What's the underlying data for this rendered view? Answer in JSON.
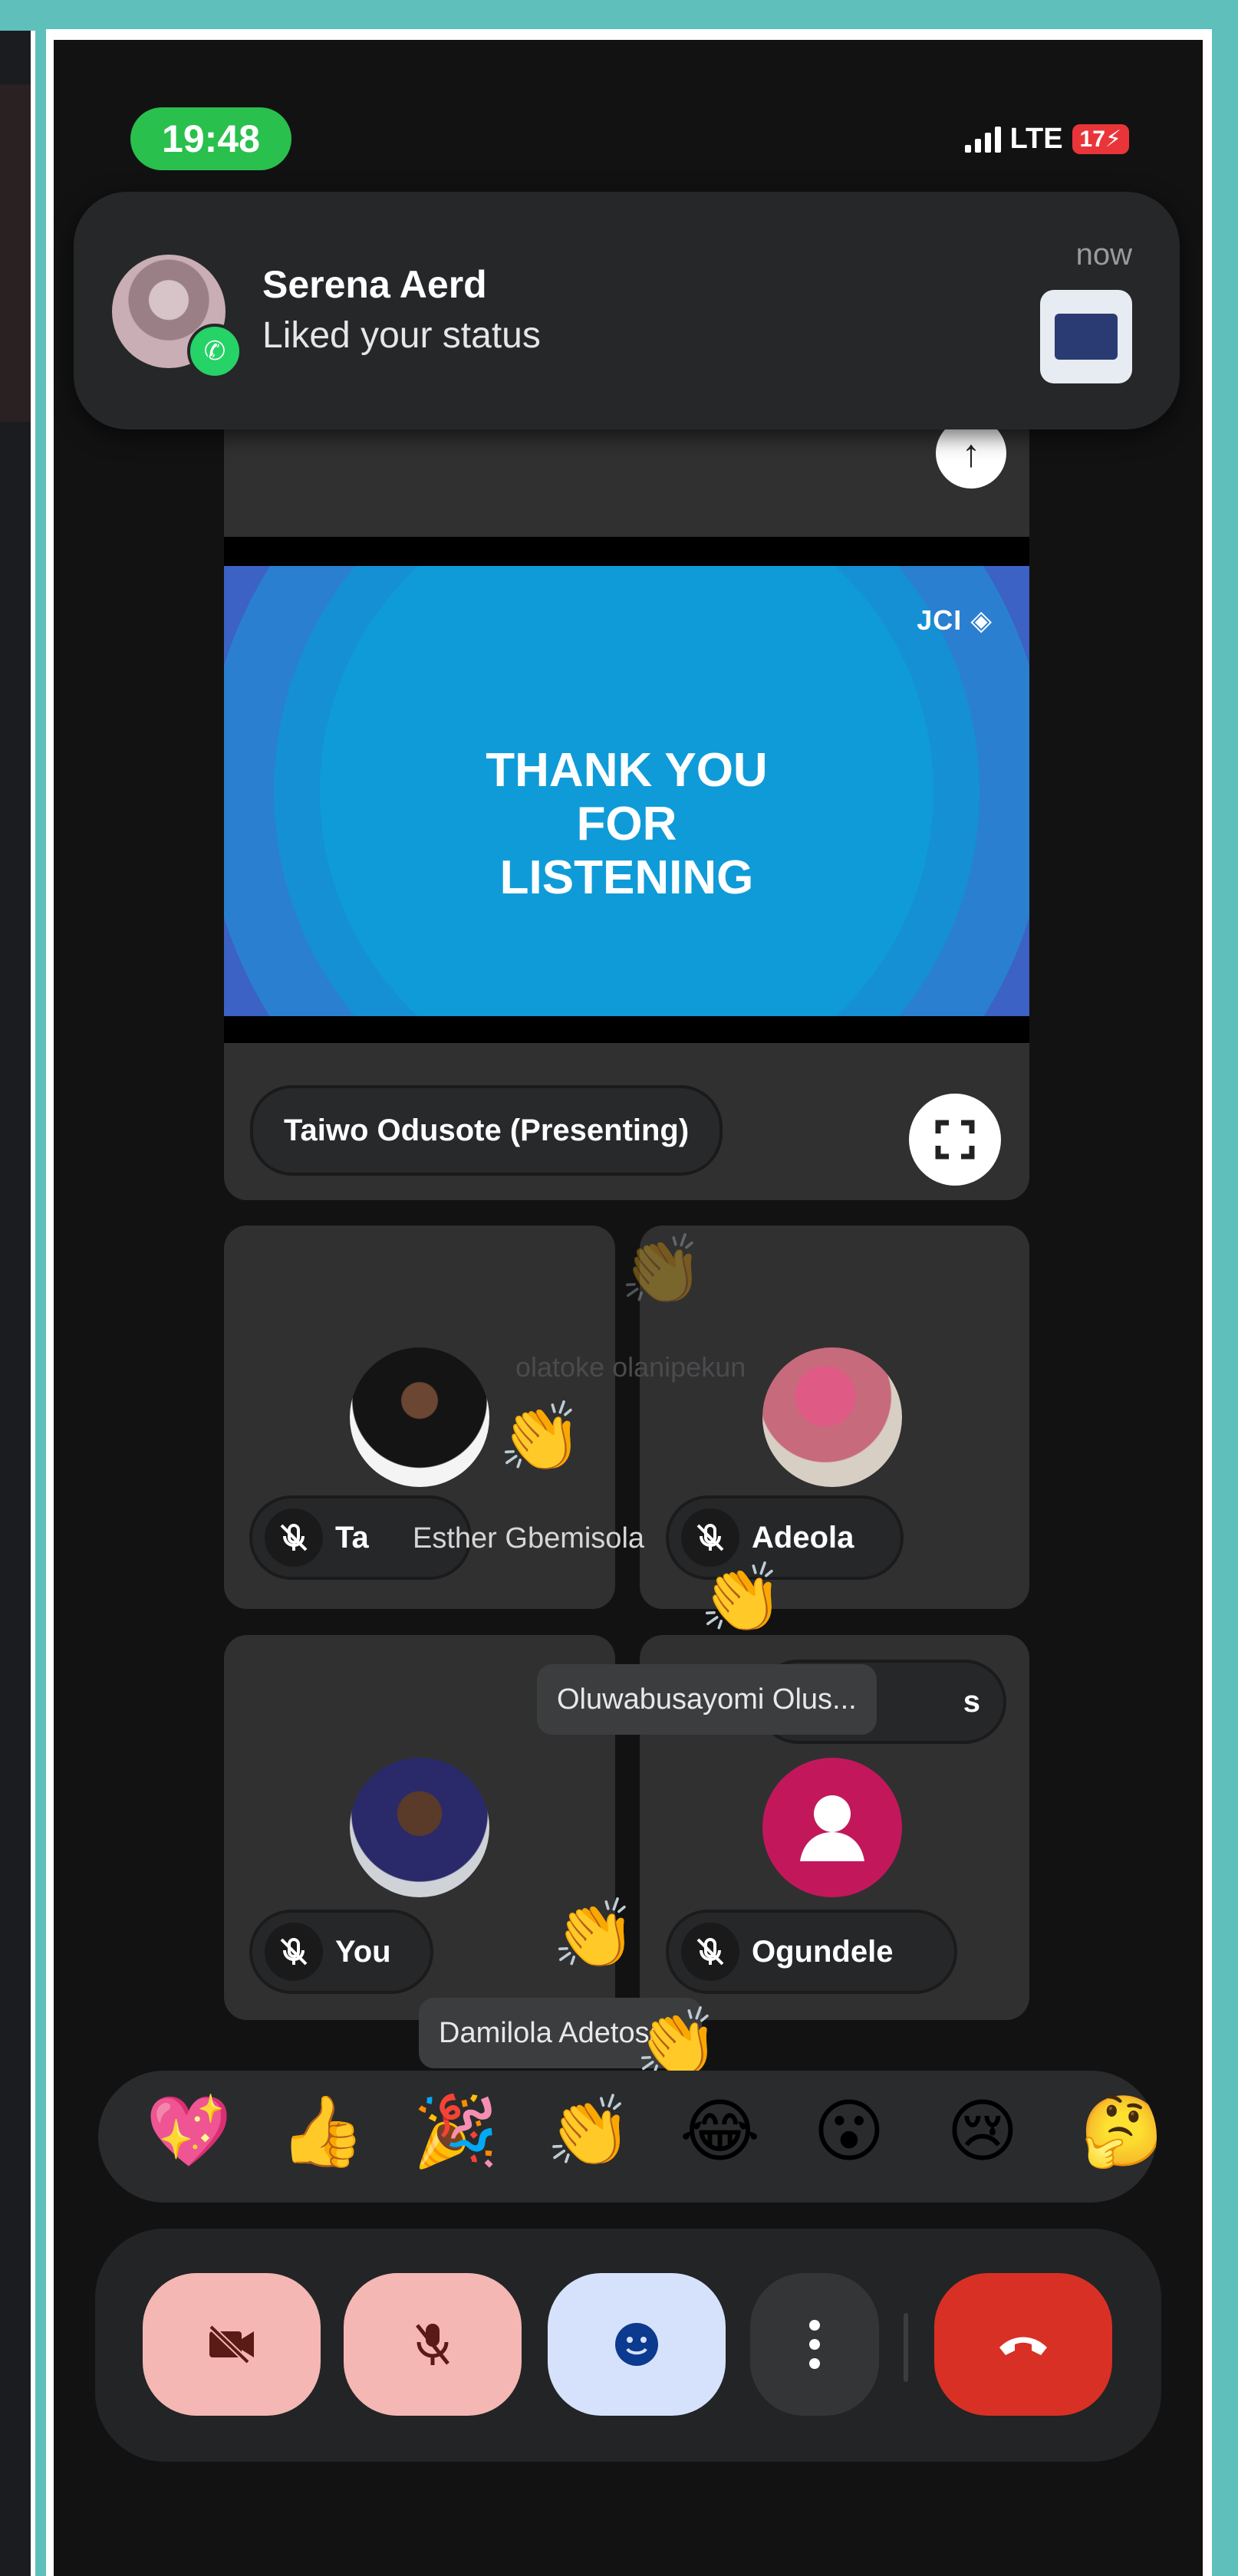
{
  "status_bar": {
    "time": "19:48",
    "network": "LTE",
    "battery": "17"
  },
  "notification": {
    "app_icon": "whatsapp-icon",
    "sender": "Serena Aerd",
    "message": "Liked your status",
    "time": "now"
  },
  "presentation": {
    "slide_title": "THANK YOU FOR LISTENING",
    "slide_logo": "JCI",
    "presenter_label": "Taiwo Odusote (Presenting)"
  },
  "participants": [
    {
      "name": "Ta",
      "overlay_name": "Esther Gbemisola",
      "muted": true
    },
    {
      "name": "Adeola",
      "overlay_name": "olatoke olanipekun",
      "muted": true
    },
    {
      "name": "You",
      "overlay_name": "Damilola Adetosan",
      "muted": true
    },
    {
      "name": "Ogundele",
      "overlay_name": "Oluwabusayomi Olus...",
      "muted": true,
      "partial_chip": "s"
    }
  ],
  "reactions": [
    "sparkling-heart",
    "thumbs-up",
    "party-popper",
    "clapping-hands",
    "tears-of-joy",
    "open-mouth",
    "crying-face",
    "thinking-face"
  ],
  "reaction_glyphs": [
    "💖",
    "👍",
    "🎉",
    "👏",
    "😂",
    "😮",
    "😢",
    "🤔"
  ],
  "controls": {
    "camera": "camera-off-icon",
    "mic": "mic-off-icon",
    "reactions": "emoji-icon",
    "more": "more-options-icon",
    "leave": "end-call-icon"
  },
  "colors": {
    "background": "#5fbfbb",
    "accent_green": "#29c04d",
    "end_call": "#d93025",
    "muted_button": "#f4b7b4",
    "emoji_button": "#d6e2fb",
    "slide_blue": "#0f9bd8"
  }
}
